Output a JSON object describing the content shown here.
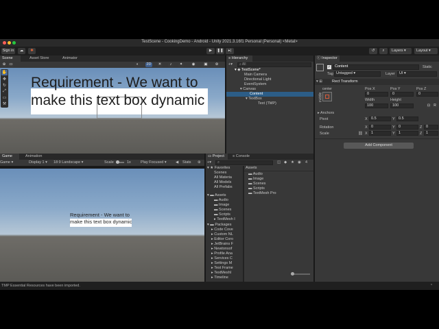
{
  "window": {
    "title": "TestScene - CookingDemo - Android - Unity 2021.3.16f1 Personal (Personal) <Metal>"
  },
  "toolbar": {
    "account": "Sign in",
    "layers": "Layers",
    "layout": "Layout"
  },
  "scene": {
    "tabs": [
      "Scene",
      "Asset Store",
      "Animator"
    ],
    "toggle_2d": "2D",
    "big_text": "Requirement - We want to make this text box dynamic"
  },
  "hierarchy": {
    "tab": "Hierarchy",
    "search": "All",
    "items": [
      "TestScene*",
      "Main Camera",
      "Directional Light",
      "EventSystem",
      "Canvas",
      "Content",
      "TextBox",
      "Text (TMP)"
    ]
  },
  "inspector": {
    "tab": "Inspector",
    "object_name": "Content",
    "static_label": "Static",
    "tag_label": "Tag",
    "tag_value": "Untagged",
    "layer_label": "Layer",
    "layer_value": "UI",
    "component": "Rect Transform",
    "anchor_label": "center",
    "side_label": "middle",
    "pos_x_label": "Pos X",
    "pos_y_label": "Pos Y",
    "pos_z_label": "Pos Z",
    "pos_x": "0",
    "pos_y": "0",
    "pos_z": "0",
    "width_label": "Width",
    "height_label": "Height",
    "width": "100",
    "height": "100",
    "anchors": "Anchors",
    "pivot_label": "Pivot",
    "pivot_x": "0.5",
    "pivot_y": "0.5",
    "rotation_label": "Rotation",
    "rot_x": "0",
    "rot_y": "0",
    "rot_z": "0",
    "scale_label": "Scale",
    "scale_x": "1",
    "scale_y": "1",
    "scale_z": "1",
    "add_component": "Add Component",
    "x": "X",
    "y": "Y",
    "z": "Z"
  },
  "game": {
    "tabs": [
      "Game",
      "Animation"
    ],
    "display_mode": "Game",
    "display": "Display 1",
    "resolution": "18:9 Landscape",
    "scale_label": "Scale",
    "scale_value": "1x",
    "play_mode": "Play Focused",
    "stats": "Stats",
    "small_text": "Requirement - We want to make this text box dynamic"
  },
  "project": {
    "tabs": [
      "Project",
      "Console"
    ],
    "favorites_label": "Favorites",
    "favorites": [
      "Scenes",
      "All Materia",
      "All Models",
      "All Prefabs"
    ],
    "assets_label": "Assets",
    "assets_tree": [
      "Audio",
      "Image",
      "Scenes",
      "Scripts",
      "TextMesh I"
    ],
    "packages_label": "Packages",
    "packages": [
      "Code Cove",
      "Custom NL",
      "Editor Coro",
      "JetBrains F",
      "Newtonsof",
      "Profile Ana",
      "Services C",
      "Settings M",
      "Test Frame",
      "TextMeshI",
      "Timeline"
    ],
    "breadcrumb": "Assets",
    "files": [
      "Audio",
      "Image",
      "Scenes",
      "Scripts",
      "TextMesh Pro"
    ],
    "badge": "4"
  },
  "status": {
    "message": "TMP Essential Resources have been imported."
  }
}
